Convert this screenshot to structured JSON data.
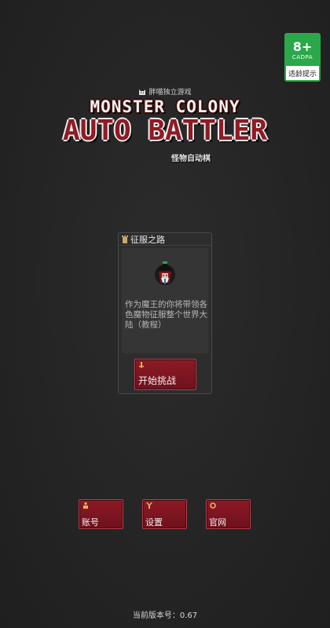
{
  "age_rating": {
    "number": "8+",
    "org": "CADPA",
    "label": "适龄提示"
  },
  "logo": {
    "publisher": "胖喵独立游戏",
    "line1": "MONSTER COLONY",
    "line2": "AUTO BATTLER",
    "subtitle": "怪物自动棋",
    "colors": {
      "primary": "#8e1b25",
      "outline": "#f0f0f0"
    }
  },
  "stage": {
    "title": "征服之路",
    "description": "作为魔王的你将带领各色魔物征服整个世界大陆（教程）",
    "start_label": "开始挑战"
  },
  "menu": {
    "account_label": "账号",
    "settings_label": "设置",
    "website_label": "官网"
  },
  "version": "当前版本号：0.67",
  "icons": {
    "stage": "tower-icon",
    "start": "sword-icon",
    "account": "person-icon",
    "settings": "wrench-icon",
    "website": "ring-icon"
  },
  "colors": {
    "button": "#8c1a26",
    "background": "#252525",
    "badge": "#2aa84a"
  }
}
